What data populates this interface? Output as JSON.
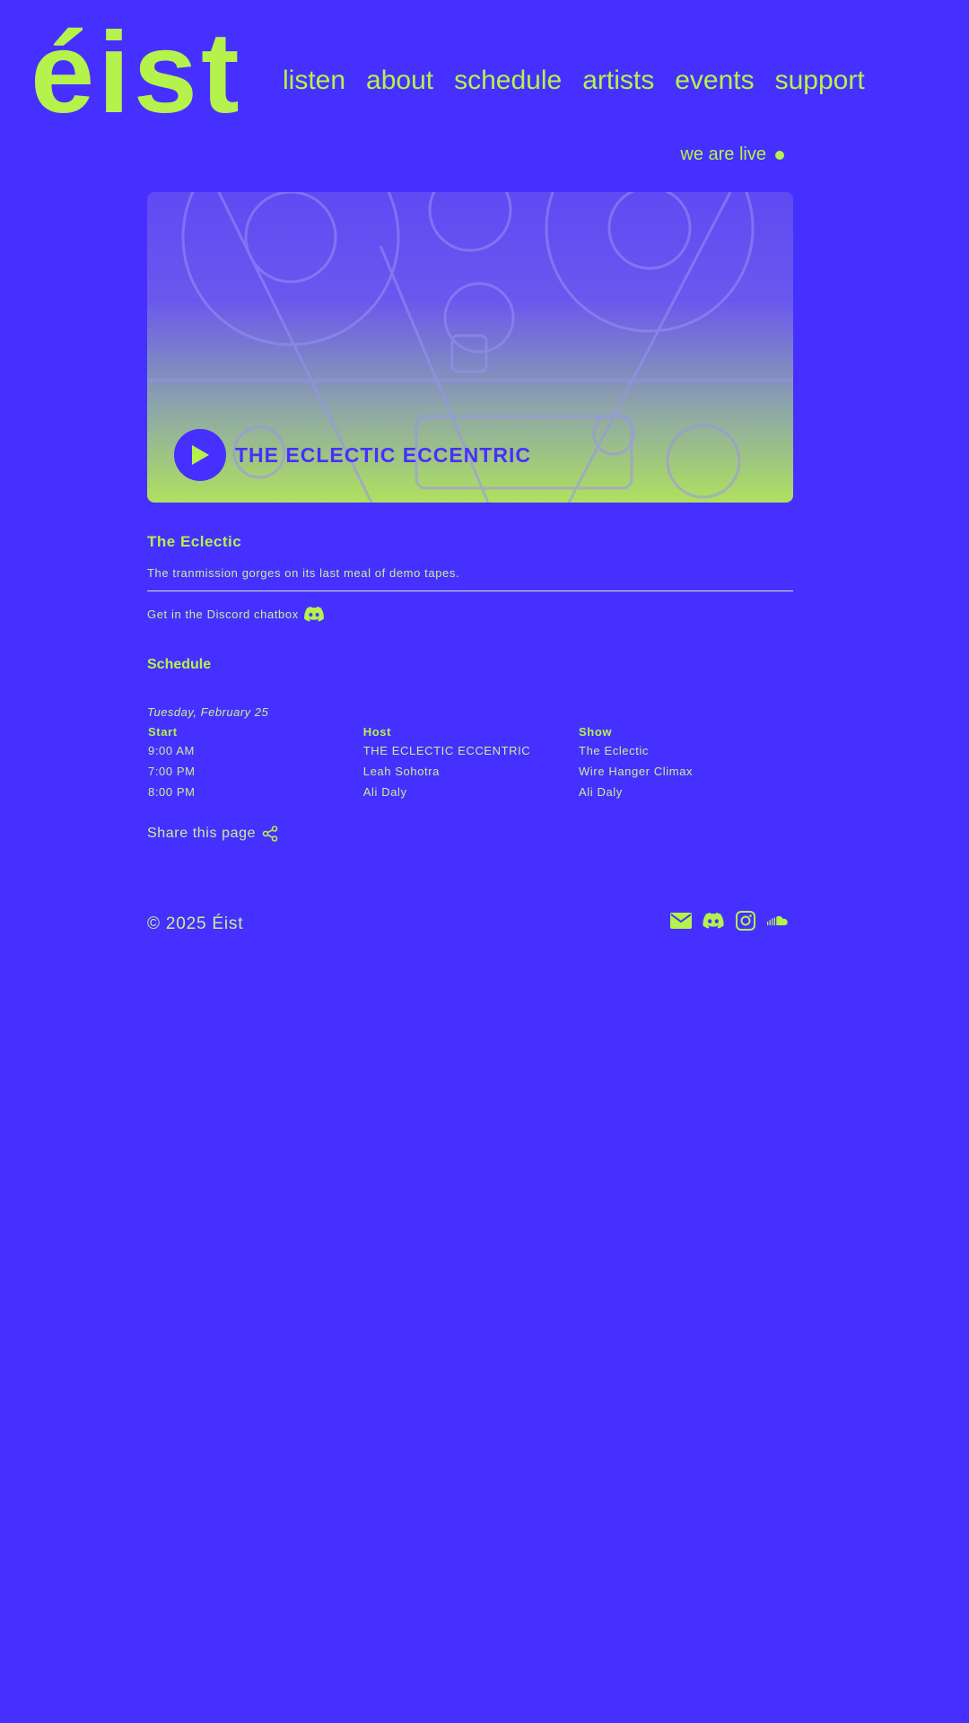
{
  "brand": {
    "logo_text": "éist"
  },
  "nav": {
    "items": [
      {
        "label": "listen"
      },
      {
        "label": "about"
      },
      {
        "label": "schedule"
      },
      {
        "label": "artists"
      },
      {
        "label": "events"
      },
      {
        "label": "support"
      }
    ]
  },
  "live": {
    "label": "we are live"
  },
  "hero": {
    "show_title": "THE ECLECTIC ECCENTRIC",
    "icon": "play-icon"
  },
  "show": {
    "title": "The Eclectic",
    "description": "The tranmission gorges on its last meal of demo tapes.",
    "discord_text": "Get in the Discord chatbox",
    "discord_icon": "discord-icon"
  },
  "schedule": {
    "title": "Schedule",
    "date": "Tuesday, February 25",
    "columns": [
      "Start",
      "Host",
      "Show"
    ],
    "rows": [
      [
        "9:00 AM",
        "THE ECLECTIC ECCENTRIC",
        "The Eclectic"
      ],
      [
        "7:00 PM",
        "Leah Sohotra",
        "Wire Hanger Climax"
      ],
      [
        "8:00 PM",
        "Ali Daly",
        "Ali Daly"
      ]
    ]
  },
  "share": {
    "label": "Share this page",
    "icon": "share-icon"
  },
  "footer": {
    "copyright": "© 2025 Éist",
    "socials": [
      "email-icon",
      "discord-icon",
      "instagram-icon",
      "soundcloud-icon"
    ]
  },
  "colors": {
    "background": "#4630FF",
    "accent": "#B5F24C"
  }
}
